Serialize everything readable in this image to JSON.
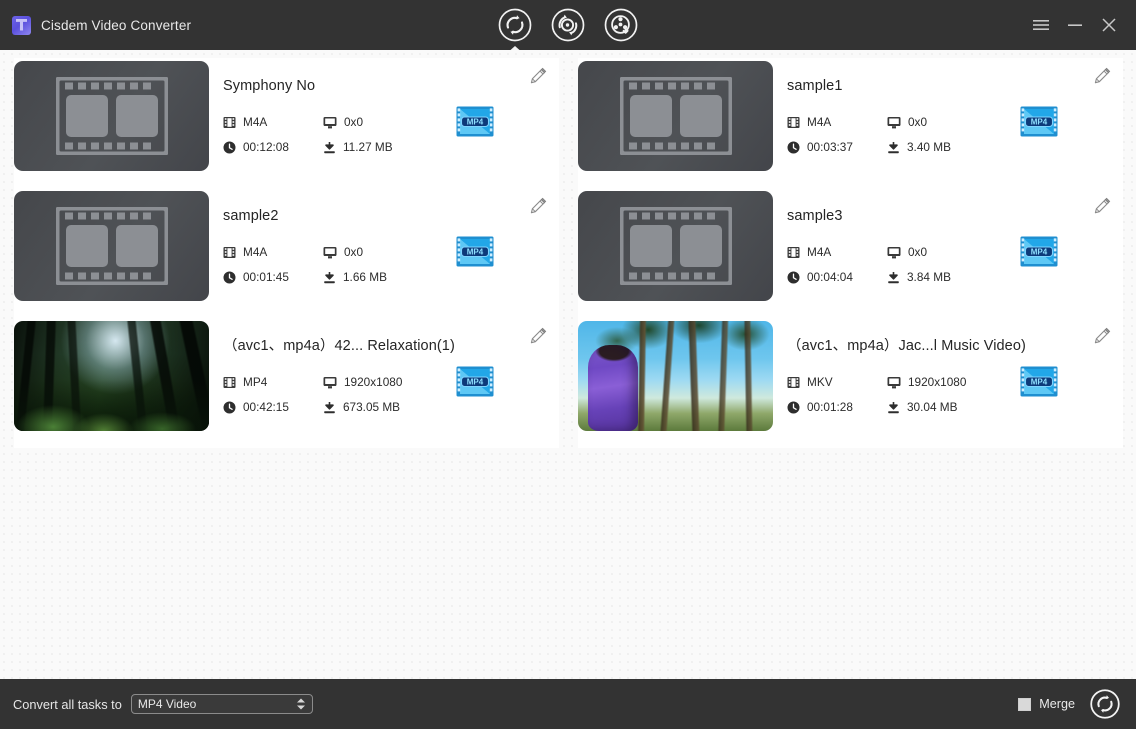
{
  "window": {
    "app_title": "Cisdem Video Converter",
    "logo_icon": "cisdem-app-logo",
    "controls": {
      "menu": "hamburger-menu-icon",
      "minimize": "minimize-icon",
      "close": "close-icon"
    }
  },
  "toolbar": {
    "tabs": [
      {
        "name": "convert",
        "icon": "convert-rotate-icon",
        "active": true
      },
      {
        "name": "dvd-ripper",
        "icon": "disc-convert-icon",
        "active": false
      },
      {
        "name": "downloader",
        "icon": "film-reel-download-icon",
        "active": false
      }
    ]
  },
  "tasks": [
    {
      "title": "Symphony No",
      "format": "M4A",
      "resolution": "0x0",
      "duration": "00:12:08",
      "size": "11.27 MB",
      "thumb": "film-placeholder",
      "output_badge": "MP4"
    },
    {
      "title": "sample1",
      "format": "M4A",
      "resolution": "0x0",
      "duration": "00:03:37",
      "size": "3.40 MB",
      "thumb": "film-placeholder",
      "output_badge": "MP4"
    },
    {
      "title": "sample2",
      "format": "M4A",
      "resolution": "0x0",
      "duration": "00:01:45",
      "size": "1.66 MB",
      "thumb": "film-placeholder",
      "output_badge": "MP4"
    },
    {
      "title": "sample3",
      "format": "M4A",
      "resolution": "0x0",
      "duration": "00:04:04",
      "size": "3.84 MB",
      "thumb": "film-placeholder",
      "output_badge": "MP4"
    },
    {
      "title": "（avc1、mp4a）42... Relaxation(1)",
      "format": "MP4",
      "resolution": "1920x1080",
      "duration": "00:42:15",
      "size": "673.05 MB",
      "thumb": "forest-sunbeam-photo",
      "output_badge": "MP4"
    },
    {
      "title": "（avc1、mp4a）Jac...l Music Video)",
      "format": "MKV",
      "resolution": "1920x1080",
      "duration": "00:01:28",
      "size": "30.04 MB",
      "thumb": "palm-trees-person-photo",
      "output_badge": "MP4"
    }
  ],
  "meta_icons": {
    "format": "filmstrip-icon",
    "resolution": "monitor-icon",
    "duration": "clock-icon",
    "size": "download-icon"
  },
  "edit_icon": "pencil-edit-icon",
  "footer": {
    "convert_all_label": "Convert all tasks to",
    "output_format": "MP4 Video",
    "merge_label": "Merge",
    "merge_checked": false,
    "start_icon": "convert-rotate-icon"
  },
  "colors": {
    "chrome": "#333333",
    "canvas": "#fafafa",
    "card": "#ffffff",
    "badge_blue": "#29a8e0",
    "badge_dark": "#0d3a7a"
  }
}
